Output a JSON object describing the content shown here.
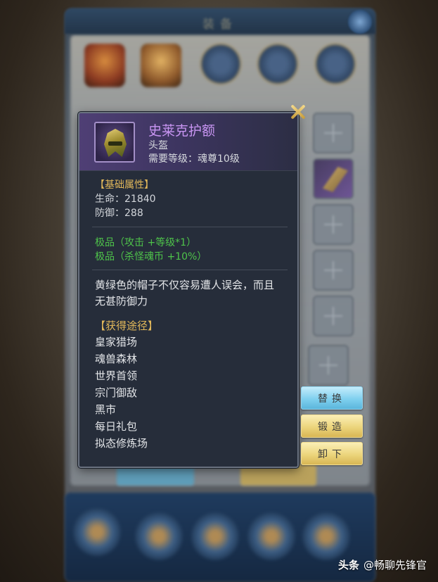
{
  "background": {
    "title": "装备"
  },
  "tooltip": {
    "item_name": "史莱克护额",
    "item_type": "头盔",
    "item_requirement": "需要等级：魂尊10级",
    "icon": "helmet-icon",
    "base_section_title": "【基础属性】",
    "stats": [
      "生命：21840",
      "防御：288"
    ],
    "bonuses": [
      "极品（攻击 +等级*1）",
      "极品（杀怪魂币 +10%）"
    ],
    "description": [
      "黄绿色的帽子不仅容易遭人误会，而且",
      "无甚防御力"
    ],
    "source_title": "【获得途径】",
    "sources": [
      "皇家猎场",
      "魂兽森林",
      "世界首领",
      "宗门御敌",
      "黑市",
      "每日礼包",
      "拟态修炼场"
    ]
  },
  "actions": {
    "replace": "替换",
    "forge": "锻造",
    "unequip": "卸下"
  },
  "watermark": {
    "brand": "头条",
    "account": "@畅聊先锋官"
  },
  "colors": {
    "item_name": "#c895f2",
    "section_title": "#e2b85a",
    "bonus_green": "#4ec34a"
  }
}
